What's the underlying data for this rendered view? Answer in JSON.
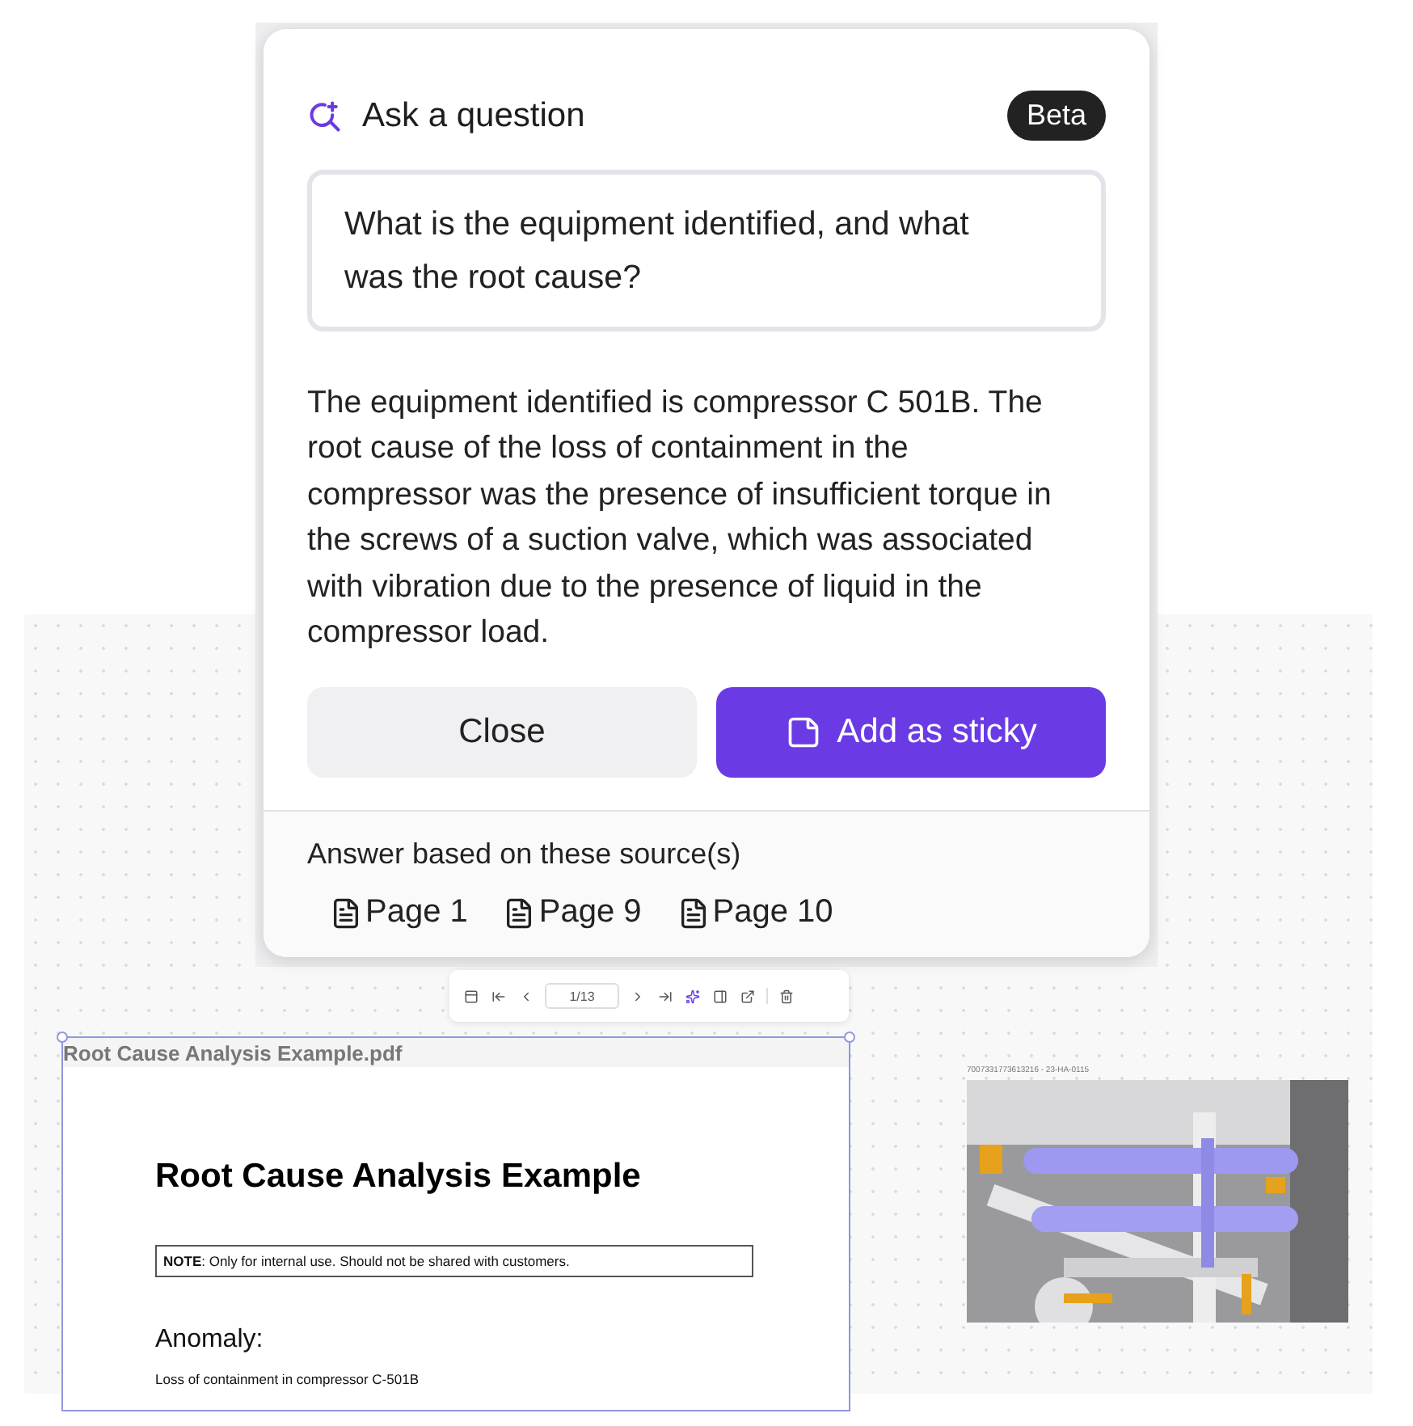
{
  "dialog": {
    "title": "Ask a question",
    "badge": "Beta",
    "question": "What is the equipment identified, and what was the root cause?",
    "answer": "The equipment identified is compressor C 501B. The root cause of the loss of containment in the compressor was the presence of insufficient torque in the screws of a suction valve, which was associated with vibration due to the presence of liquid in the compressor load.",
    "buttons": [
      {
        "label": "Close",
        "kind": "secondary"
      },
      {
        "label": "Add as sticky",
        "kind": "primary"
      }
    ],
    "sources_label": "Answer based on these source(s)",
    "sources": [
      "Page 1",
      "Page 9",
      "Page 10"
    ]
  },
  "toolbar": {
    "page_field": "1/13"
  },
  "pdf": {
    "filename": "Root Cause Analysis Example.pdf",
    "heading": "Root Cause Analysis Example",
    "note": "**NOTE**: Only for internal use. Should not be shared with customers.",
    "section_heading": "Anomaly:",
    "section_text": "Loss of containment in compressor C-501B"
  },
  "image": {
    "caption": "7007331773613216 - 23-HA-0115",
    "kind": "picture"
  }
}
